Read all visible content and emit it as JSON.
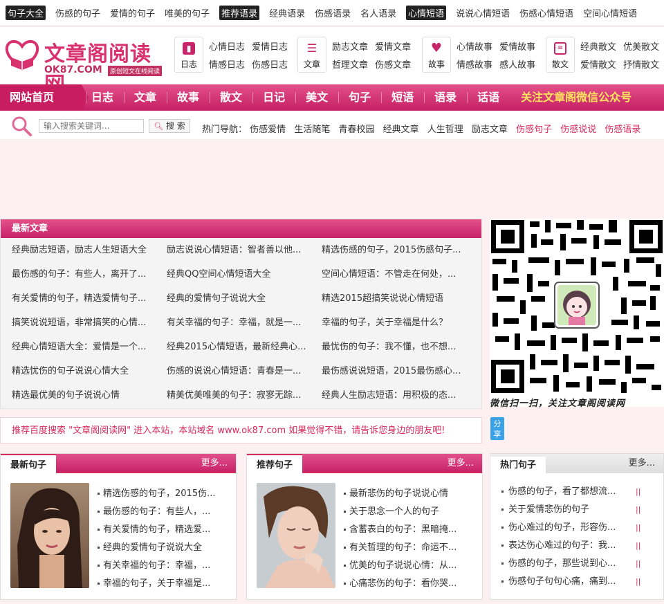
{
  "topbar": {
    "items": [
      {
        "label": "句子大全",
        "highlight": true
      },
      {
        "label": "伤感的句子",
        "highlight": false
      },
      {
        "label": "爱情的句子",
        "highlight": false
      },
      {
        "label": "唯美的句子",
        "highlight": false
      },
      {
        "label": "推荐语录",
        "highlight": true
      },
      {
        "label": "经典语录",
        "highlight": false
      },
      {
        "label": "伤感语录",
        "highlight": false
      },
      {
        "label": "名人语录",
        "highlight": false
      },
      {
        "label": "心情短语",
        "highlight": true
      },
      {
        "label": "说说心情短语",
        "highlight": false
      },
      {
        "label": "伤感心情短语",
        "highlight": false
      },
      {
        "label": "空间心情短语",
        "highlight": false
      }
    ]
  },
  "logo": {
    "title": "文章阁阅读网",
    "domain": "OK87.COM",
    "tagline": "原创短文在线阅读"
  },
  "categories": [
    {
      "label": "日志",
      "icon": "book-icon",
      "links": [
        "心情日志",
        "爱情日志",
        "情感日志",
        "伤感日志"
      ]
    },
    {
      "label": "文章",
      "icon": "list-icon",
      "links": [
        "励志文章",
        "爱情文章",
        "哲理文章",
        "伤感文章"
      ]
    },
    {
      "label": "故事",
      "icon": "heart-icon",
      "links": [
        "心情故事",
        "爱情故事",
        "情感故事",
        "感人故事"
      ]
    },
    {
      "label": "散文",
      "icon": "scroll-icon",
      "links": [
        "经典散文",
        "优美散文",
        "爱情散文",
        "抒情散文"
      ]
    }
  ],
  "nav": {
    "home": "网站首页",
    "items": [
      "日志",
      "文章",
      "故事",
      "散文",
      "日记",
      "美文",
      "句子",
      "短语",
      "语录",
      "话语"
    ],
    "weixin": "关注文章阁微信公众号"
  },
  "search": {
    "placeholder": "输入搜索关键词...",
    "button": "搜 索",
    "hot_label": "热门导航：",
    "hot_links": [
      {
        "label": "伤感爱情",
        "red": false
      },
      {
        "label": "生活随笔",
        "red": false
      },
      {
        "label": "青春校园",
        "red": false
      },
      {
        "label": "经典文章",
        "red": false
      },
      {
        "label": "人生哲理",
        "red": false
      },
      {
        "label": "励志文章",
        "red": false
      },
      {
        "label": "伤感句子",
        "red": true
      },
      {
        "label": "伤感说说",
        "red": true
      },
      {
        "label": "伤感语录",
        "red": true
      }
    ]
  },
  "latest": {
    "title": "最新文章",
    "items": [
      "经典励志短语，励志人生短语大全",
      "励志说说心情短语：智者善以他...",
      "精选伤感的句子，2015伤感句子...",
      "最伤感的句子：有些人，离开了...",
      "经典QQ空间心情短语大全",
      "空间心情短语：不管走在何处，...",
      "有关爱情的句子，精选爱情句子...",
      "经典的爱情句子说说大全",
      "精选2015超搞笑说说心情短语",
      "搞笑说说短语，非常搞笑的心情...",
      "有关幸福的句子：幸福，就是一...",
      "幸福的句子，关于幸福是什么？",
      "经典心情短语大全：爱情是一个...",
      "经典2015心情短语，最新经典心...",
      "最忧伤的句子：我不懂，也不想...",
      "精选忧伤的句子说说心情大全",
      "伤感的说说心情短语：青春是一...",
      "最伤感说说短语，2015最伤感心...",
      "精选最优美的句子说说心情",
      "精美优美唯美的句子：寂寥无踪...",
      "经典人生励志短语：用积极的态..."
    ]
  },
  "qr": {
    "caption": "微信扫一扫，关注文章阁阅读网"
  },
  "recommend": {
    "text": "推荐百度搜索 \"文章阁阅读网\" 进入本站，本站域名 www.ok87.com 如果觉得不错，请告诉您身边的朋友吧!"
  },
  "share": {
    "label": "分享"
  },
  "panels": [
    {
      "title": "最新句子",
      "more": "更多...",
      "items": [
        "精选伤感的句子，2015伤...",
        "最伤感的句子：有些人，...",
        "有关爱情的句子，精选爱...",
        "经典的爱情句子说说大全",
        "有关幸福的句子：幸福，...",
        "幸福的句子，关于幸福是..."
      ]
    },
    {
      "title": "推荐句子",
      "more": "更多...",
      "items": [
        "最新悲伤的句子说说心情",
        "关于思念一个人的句子",
        "含蓄表白的句子：黑暗掩...",
        "有关哲理的句子：命运不...",
        "优美的句子说说心情：从...",
        "心痛悲伤的句子：看你哭..."
      ]
    }
  ],
  "hot_sentences": {
    "title": "热门句子",
    "more": "更多...",
    "mark": "||",
    "items": [
      "伤感的句子，看了都想流...",
      "关于爱情悲伤的句子",
      "伤心难过的句子，形容伤...",
      "表达伤心难过的句子：我...",
      "伤感的句子，那些说到心...",
      "伤感句子句句心痛，痛到..."
    ]
  },
  "colors": {
    "brand": "#d62a5d",
    "nav_dark": "#c61f64",
    "link_red": "#d62a5d",
    "qr_blue": "#3ba2e8"
  }
}
